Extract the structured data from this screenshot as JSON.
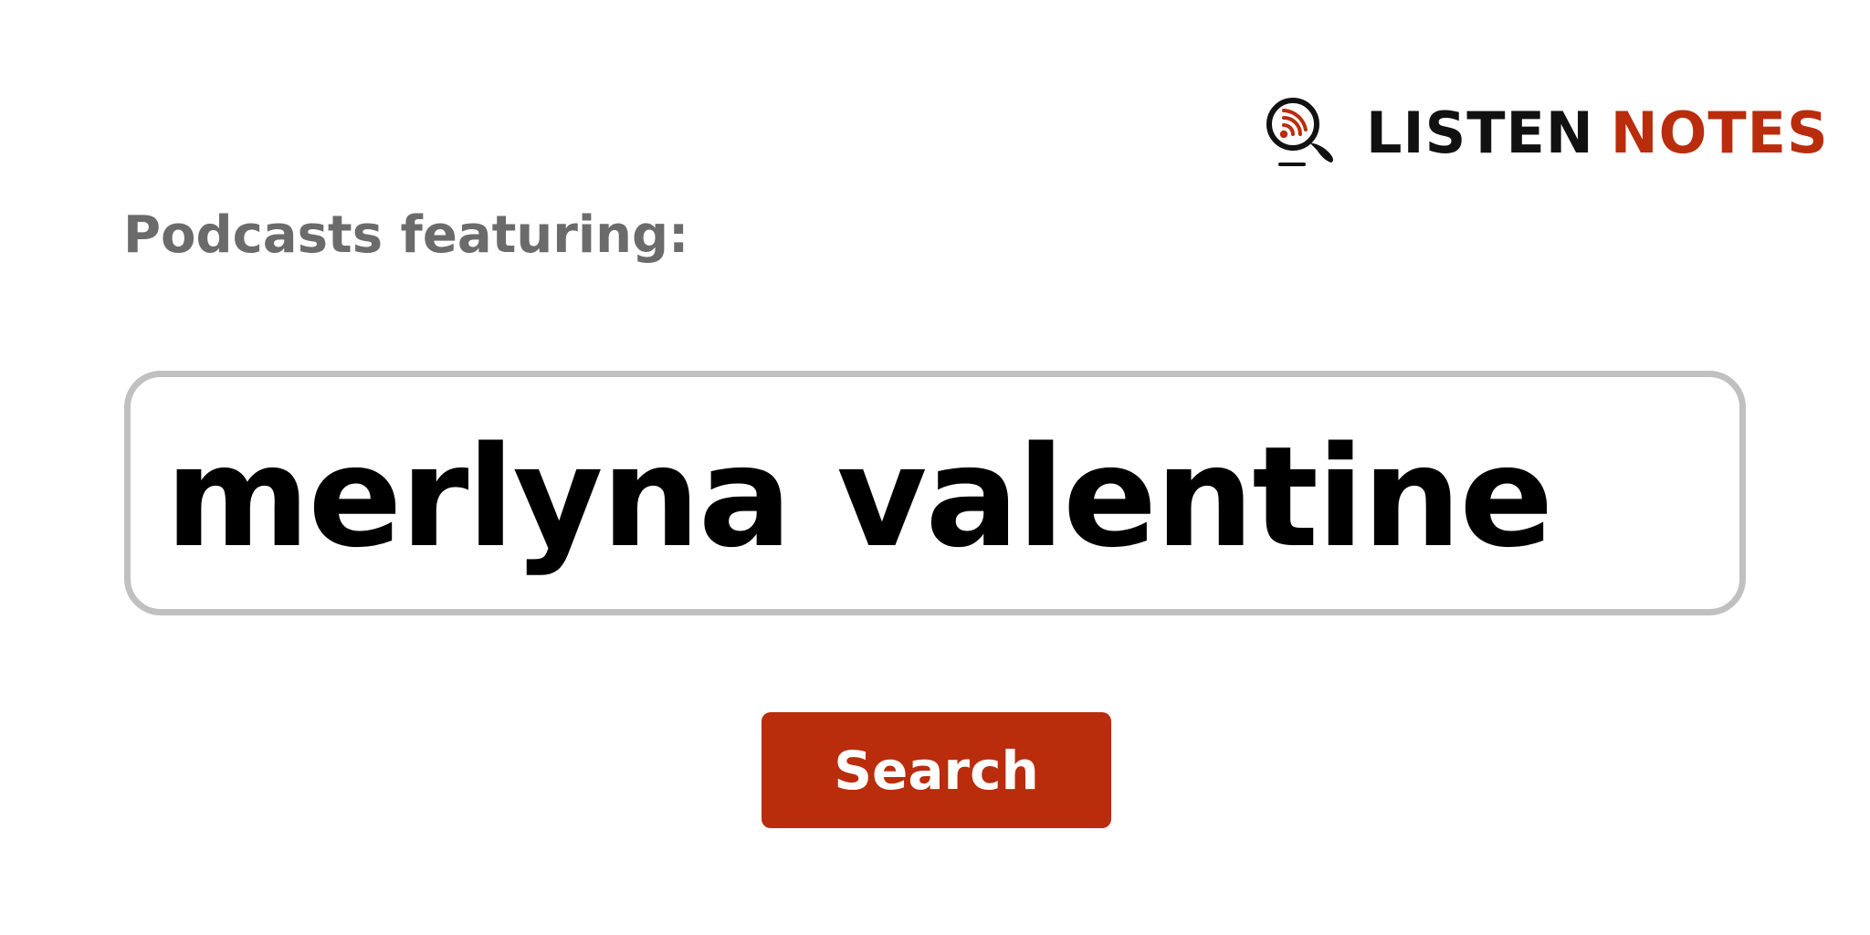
{
  "logo": {
    "word1": "LISTEN",
    "word2": "NOTES",
    "icon": "podcast-search-icon",
    "colors": {
      "dark": "#111111",
      "accent": "#b92d0d"
    }
  },
  "heading": "Podcasts featuring:",
  "search": {
    "value": "merlyna valentine",
    "button_label": "Search"
  },
  "colors": {
    "brand": "#b92d0d",
    "heading_text": "#6b6b6b",
    "input_border": "#c0c0c0"
  }
}
